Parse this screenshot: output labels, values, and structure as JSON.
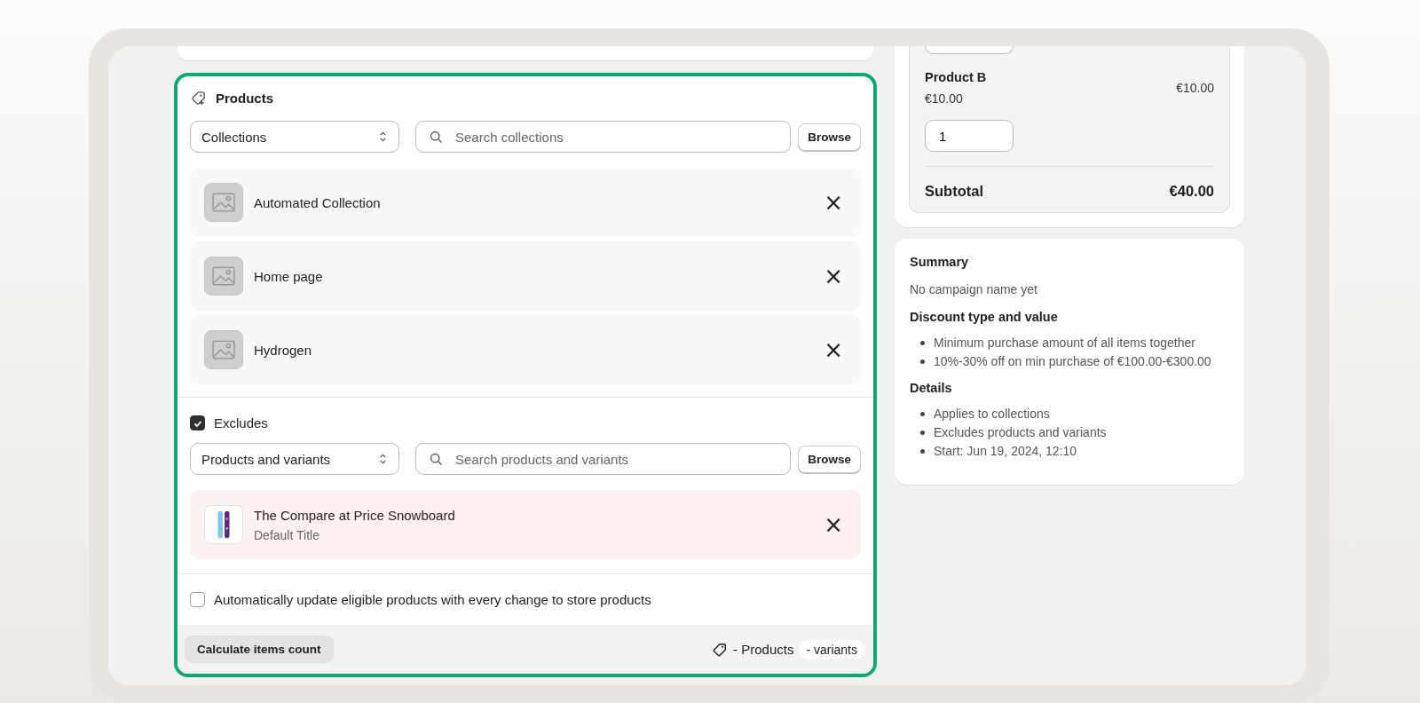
{
  "products_card": {
    "title": "Products",
    "scope_select": {
      "value": "Collections"
    },
    "search": {
      "placeholder": "Search collections"
    },
    "browse_button": "Browse",
    "items": [
      {
        "name": "Automated Collection",
        "remove": "×"
      },
      {
        "name": "Home page",
        "remove": "×"
      },
      {
        "name": "Hydrogen",
        "remove": "×"
      }
    ],
    "excludes": {
      "label": "Excludes",
      "checked": true,
      "type_select": {
        "value": "Products and variants"
      },
      "search": {
        "placeholder": "Search products and variants"
      },
      "browse_button": "Browse",
      "items": [
        {
          "name": "The Compare at Price Snowboard",
          "variant": "Default Title",
          "remove": "×"
        }
      ]
    },
    "auto_update": {
      "label": "Automatically update eligible products with every change to store products",
      "checked": false
    },
    "footer": {
      "button": "Calculate items count",
      "products_count": "- Products",
      "variants_count": "- variants"
    }
  },
  "cart_card": {
    "items": [
      {
        "name": "Product B",
        "unit_price": "€10.00",
        "line_total": "€10.00",
        "quantity": "1"
      }
    ],
    "subtotal": {
      "label": "Subtotal",
      "value": "€40.00"
    }
  },
  "summary_card": {
    "title": "Summary",
    "campaign": "No campaign name yet",
    "sections": [
      {
        "heading": "Discount type and value",
        "bullets": [
          "Minimum purchase amount of all items together",
          "10%-30% off on min purchase of €100.00-€300.00"
        ]
      },
      {
        "heading": "Details",
        "bullets": [
          "Applies to collections",
          "Excludes products and variants",
          "Start: Jun 19, 2024, 12:10"
        ]
      }
    ]
  }
}
